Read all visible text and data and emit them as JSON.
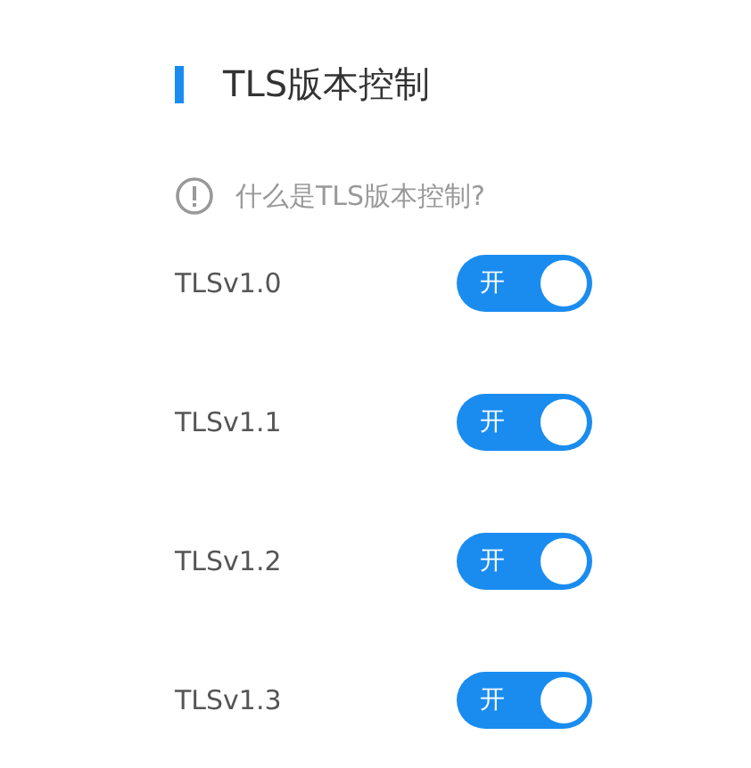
{
  "section": {
    "title": "TLS版本控制"
  },
  "help_link": {
    "text": "什么是TLS版本控制?"
  },
  "versions": [
    {
      "name": "TLSv1.0",
      "on": true,
      "switch_label": "开"
    },
    {
      "name": "TLSv1.1",
      "on": true,
      "switch_label": "开"
    },
    {
      "name": "TLSv1.2",
      "on": true,
      "switch_label": "开"
    },
    {
      "name": "TLSv1.3",
      "on": true,
      "switch_label": "开"
    }
  ]
}
